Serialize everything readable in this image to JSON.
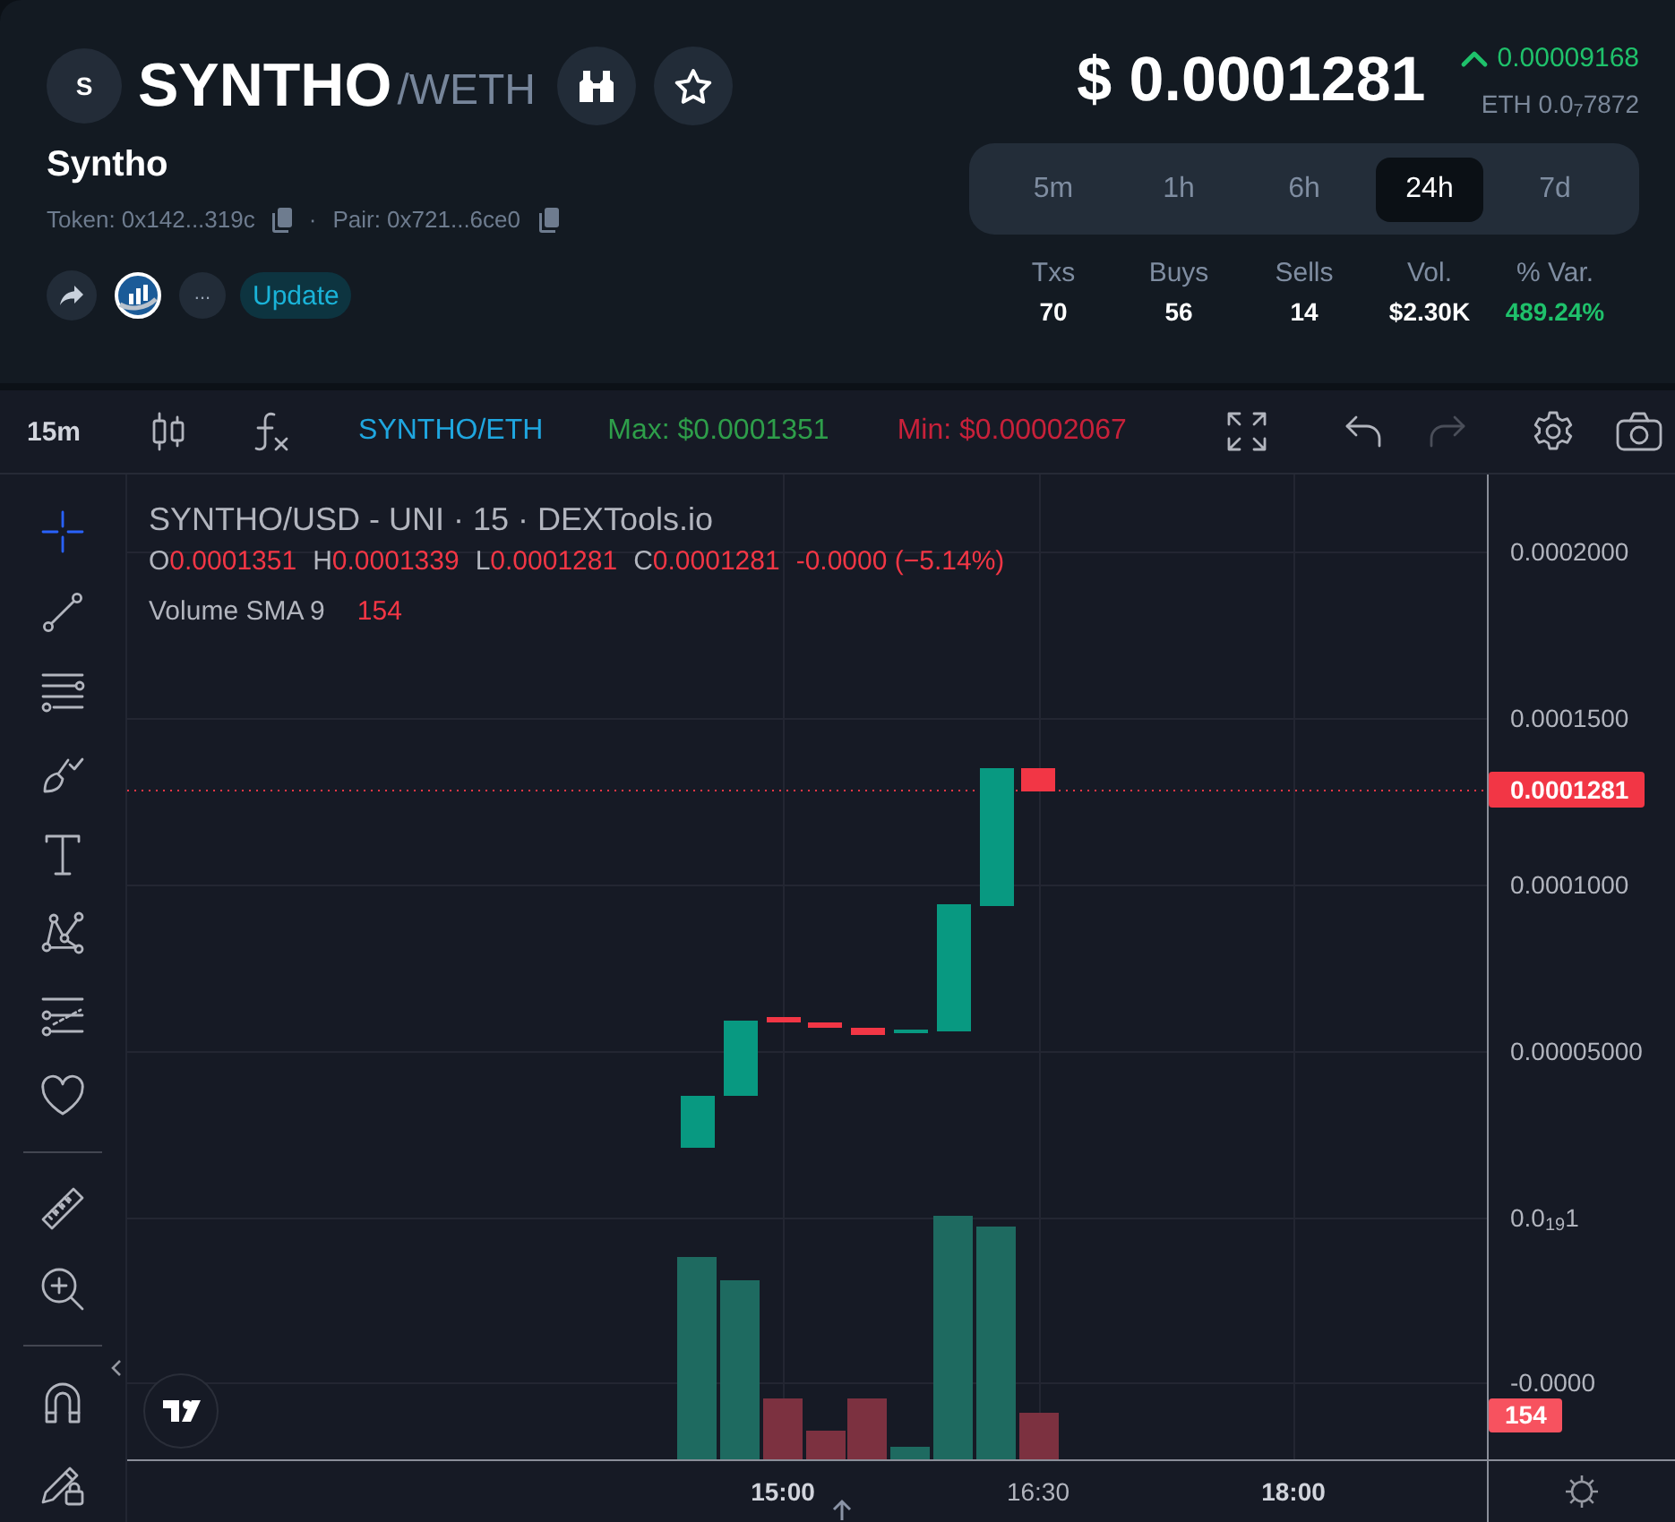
{
  "header": {
    "avatar": "S",
    "symbol": "SYNTHO",
    "quote": "/WETH",
    "name": "Syntho",
    "token": "Token: 0x142...319c",
    "separator": "·",
    "pair": "Pair: 0x721...6ce0",
    "more": "...",
    "badge": "Update"
  },
  "price": {
    "value": "$ 0.0001281",
    "change": {
      "rising": true,
      "value": "0.00009168"
    },
    "eth": "ETH 0.0$_{7}$7872"
  },
  "timeframes": [
    {
      "label": "5m",
      "selected": false
    },
    {
      "label": "1h",
      "selected": false
    },
    {
      "label": "6h",
      "selected": false
    },
    {
      "label": "24h",
      "selected": true
    },
    {
      "label": "7d",
      "selected": false
    }
  ],
  "stats": [
    {
      "label": "Txs",
      "value": "70",
      "kind": "plain"
    },
    {
      "label": "Buys",
      "value": "56",
      "kind": "plain"
    },
    {
      "label": "Sells",
      "value": "14",
      "kind": "plain"
    },
    {
      "label": "Vol.",
      "value": "$2.30K",
      "kind": "plain"
    },
    {
      "label": "% Var.",
      "value": "489.24%",
      "kind": "positive"
    }
  ],
  "toolbar": {
    "interval": "15m",
    "pair": "SYNTHO/ETH",
    "max": "Max: $0.0001351",
    "min": "Min: $0.00002067",
    "undo": {
      "disabled": false
    },
    "redo": {
      "disabled": true
    }
  },
  "tool_groups": [
    {
      "tools": [
        {
          "kind": "cursor",
          "selected": true
        },
        {
          "kind": "line",
          "selected": false
        },
        {
          "kind": "fibonacci",
          "selected": false
        },
        {
          "kind": "brush",
          "selected": false
        },
        {
          "kind": "text",
          "selected": false
        },
        {
          "kind": "pattern",
          "selected": false
        },
        {
          "kind": "forecast",
          "selected": false
        },
        {
          "kind": "favorites",
          "selected": false
        }
      ]
    },
    {
      "tools": [
        {
          "kind": "measure",
          "selected": false
        },
        {
          "kind": "zoom",
          "selected": false
        }
      ]
    },
    {
      "tools": [
        {
          "kind": "magnet",
          "selected": false
        },
        {
          "kind": "lock",
          "selected": false
        }
      ]
    }
  ],
  "chart": {
    "legend": {
      "title": "SYNTHO/USD - UNI · 15 · DEXTools.io",
      "ohlc": [
        {
          "key": "O",
          "value": "0.0001351"
        },
        {
          "key": "H",
          "value": "0.0001339"
        },
        {
          "key": "L",
          "value": "0.0001281"
        },
        {
          "key": "C",
          "value": "0.0001281"
        }
      ],
      "change": "-0.0000 (−5.14%)",
      "indicator": "Volume SMA 9",
      "indicator_value": "154"
    },
    "price_axis": [
      "0.0002000",
      "0.0001500",
      "0.0001000",
      "0.00005000",
      "0.0$_{19}$1",
      "-0.0000"
    ],
    "last_price": "0.0001281",
    "volume_value": "154",
    "time_axis": [
      {
        "label": "15:00",
        "bold": true
      },
      {
        "label": "16:30",
        "bold": false
      },
      {
        "label": "18:00",
        "bold": true
      }
    ]
  }
}
